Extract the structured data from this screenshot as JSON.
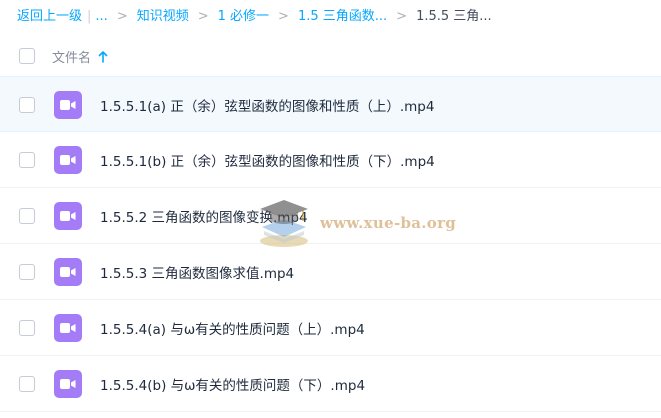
{
  "breadcrumb": {
    "back_label": "返回上一级",
    "pipe": "|",
    "ellipsis": "...",
    "separator": ">",
    "items": [
      "知识视频",
      "1 必修一",
      "1.5 三角函数..."
    ],
    "current": "1.5.5 三角..."
  },
  "header": {
    "column_name": "文件名"
  },
  "files": [
    {
      "name": "1.5.5.1(a) 正（余）弦型函数的图像和性质（上）.mp4",
      "icon": "video-icon"
    },
    {
      "name": "1.5.5.1(b) 正（余）弦型函数的图像和性质（下）.mp4",
      "icon": "video-icon"
    },
    {
      "name": "1.5.5.2 三角函数的图像变换.mp4",
      "icon": "video-icon"
    },
    {
      "name": "1.5.5.3 三角函数图像求值.mp4",
      "icon": "video-icon"
    },
    {
      "name": "1.5.5.4(a) 与ω有关的性质问题（上）.mp4",
      "icon": "video-icon"
    },
    {
      "name": "1.5.5.4(b) 与ω有关的性质问题（下）.mp4",
      "icon": "video-icon"
    }
  ],
  "watermark": {
    "text": "www.xue-ba.org"
  },
  "colors": {
    "link": "#06a7ff",
    "video_icon_bg": "#a57cf7",
    "hover_row": "#f4f9fe"
  }
}
